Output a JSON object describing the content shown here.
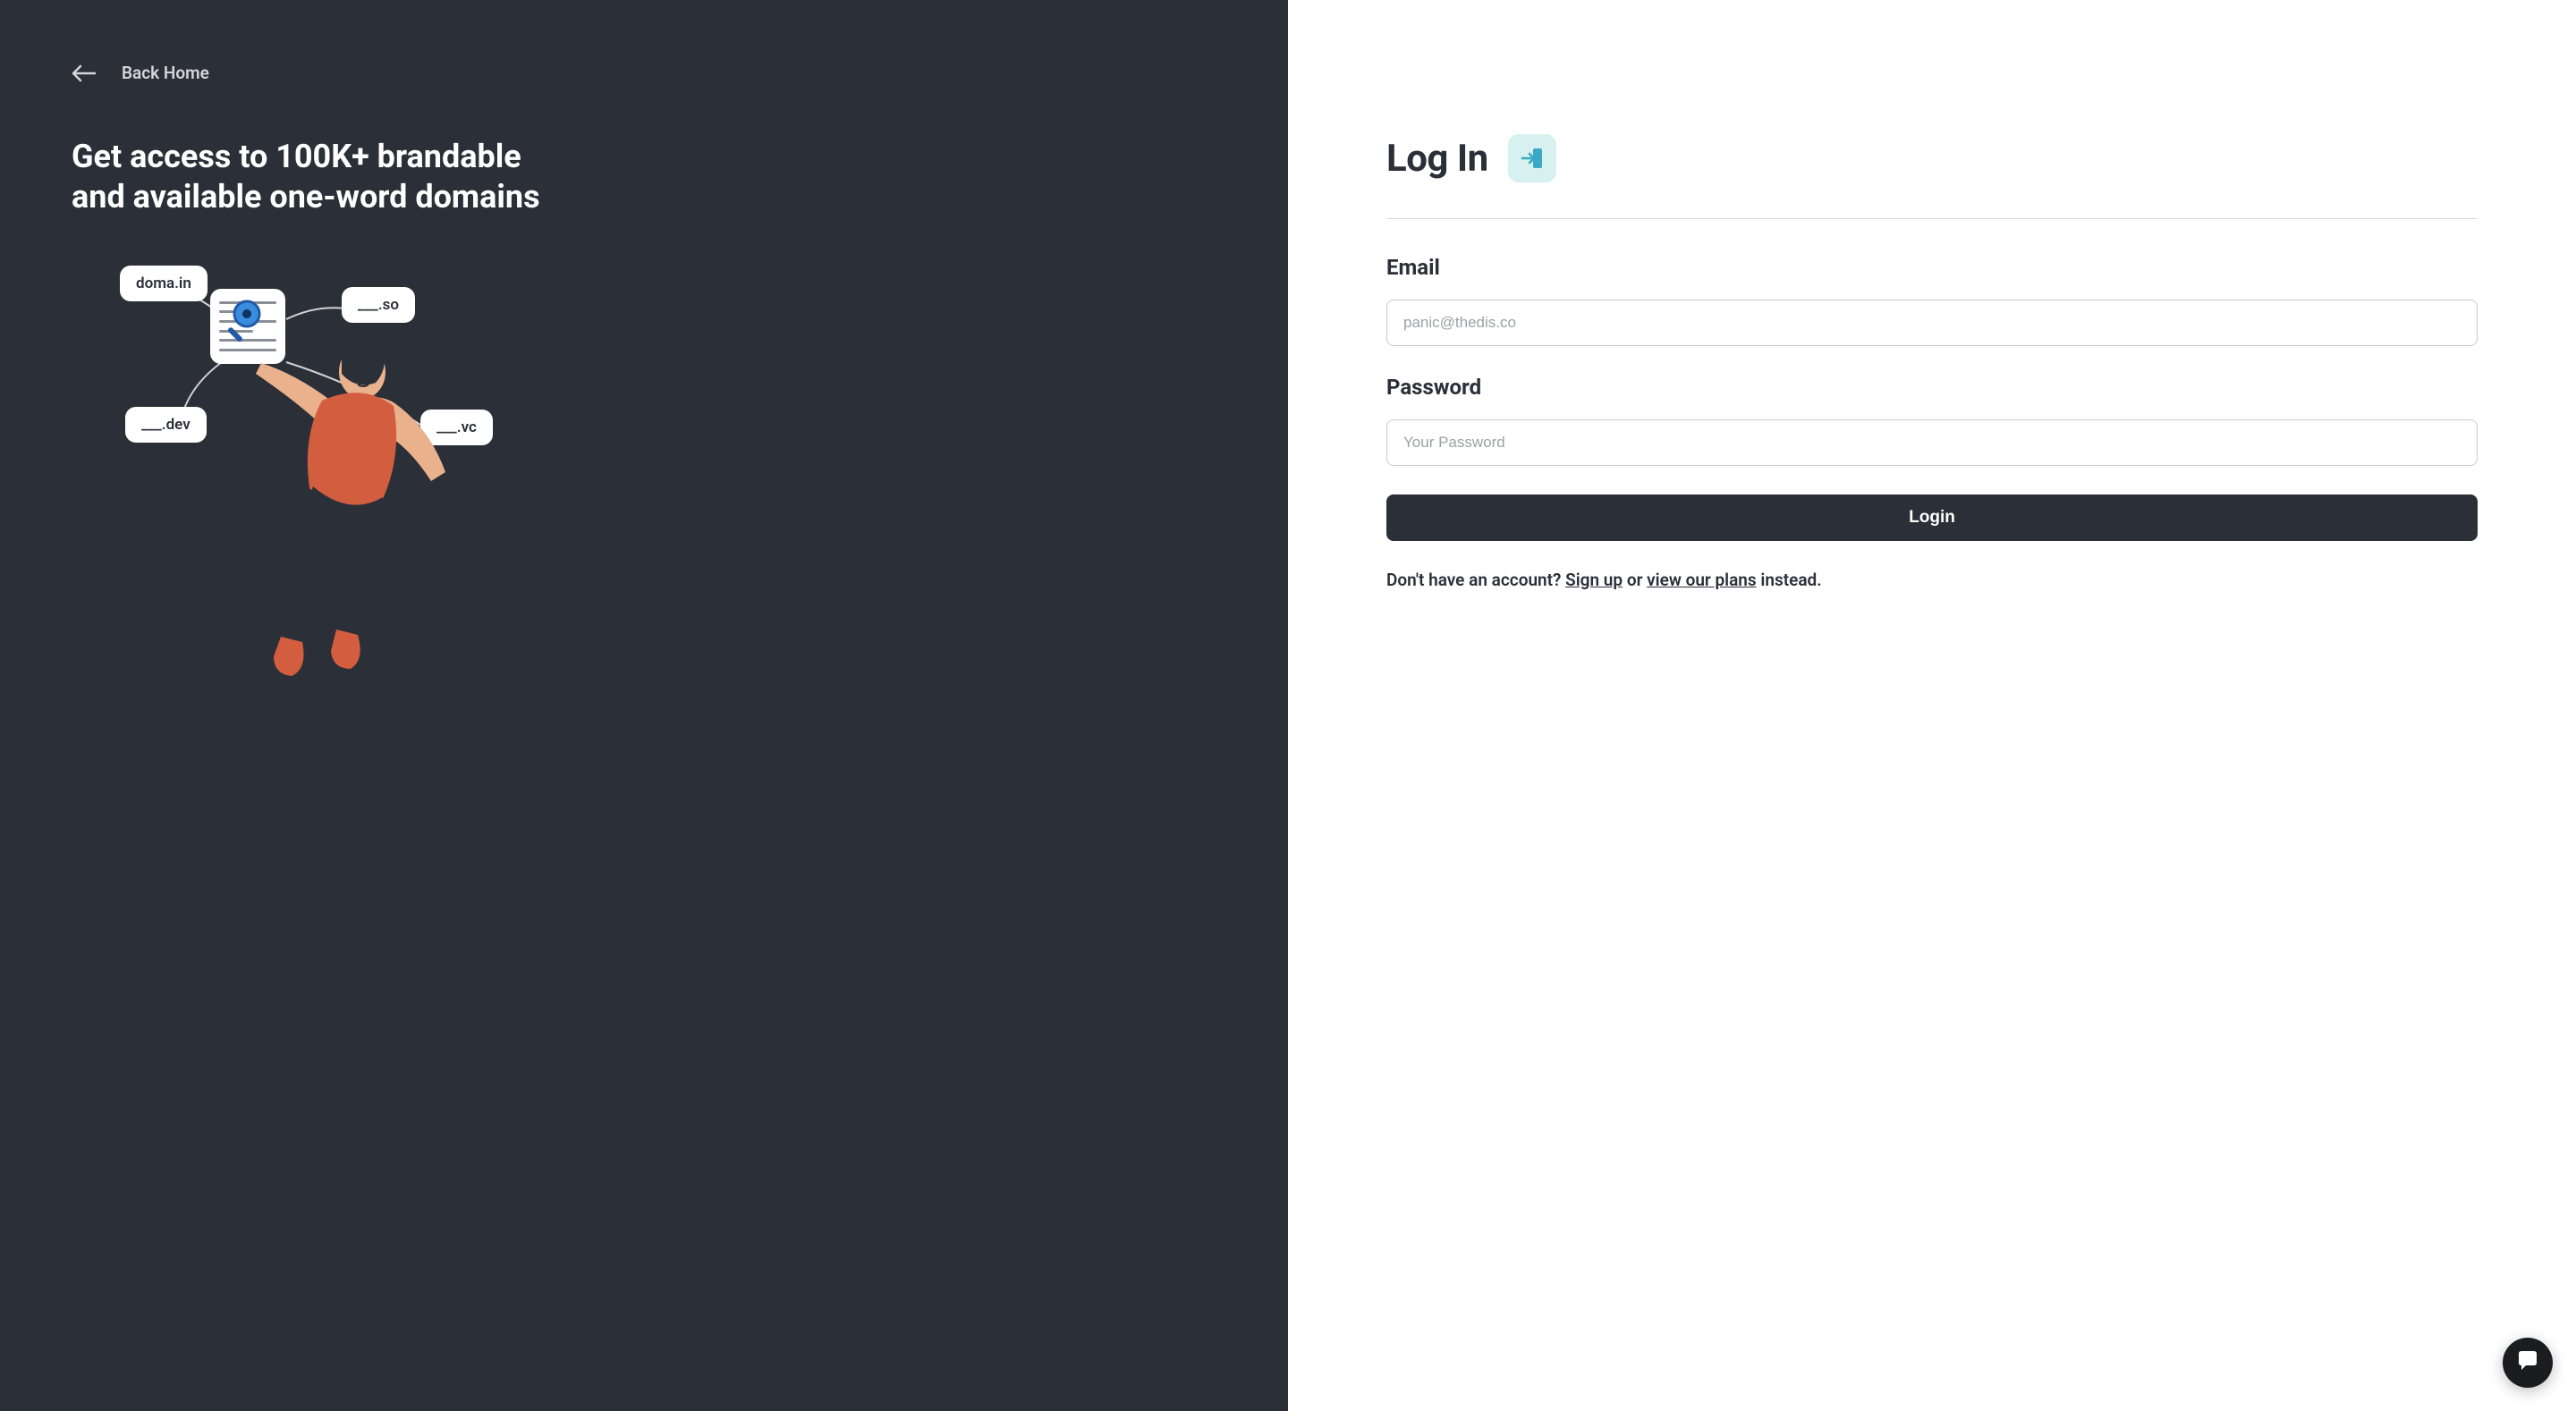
{
  "left": {
    "back_label": "Back Home",
    "heading": "Get access to 100K+ brandable and available one-word domains",
    "bubbles": {
      "domain": "doma.in",
      "so": "___.so",
      "dev": "___.dev",
      "vc": "___.vc"
    }
  },
  "form": {
    "title": "Log In",
    "email_label": "Email",
    "email_placeholder": "panic@thedis.co",
    "email_value": "",
    "password_label": "Password",
    "password_placeholder": "Your Password",
    "password_value": "",
    "submit_label": "Login",
    "signup_prefix": "Don't have an account? ",
    "signup_link": "Sign up",
    "signup_middle": " or ",
    "plans_link": "view our plans",
    "signup_suffix": " instead."
  }
}
